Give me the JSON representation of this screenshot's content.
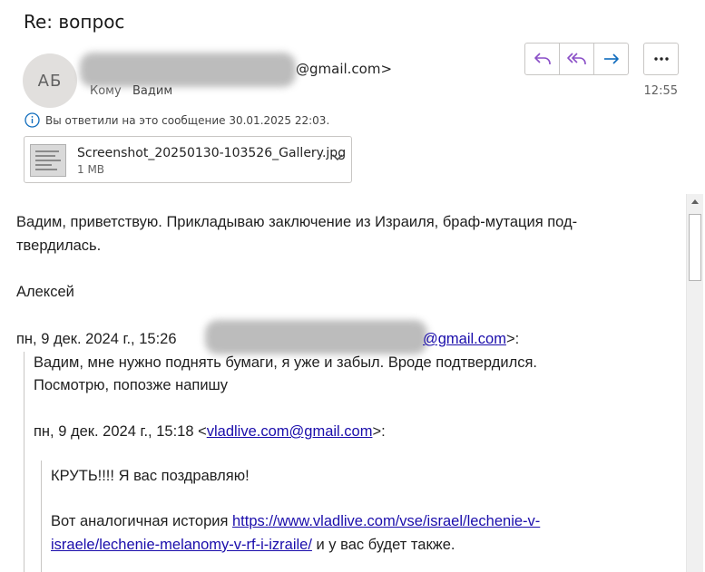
{
  "subject": "Re: вопрос",
  "sender": {
    "initials": "АБ",
    "email_domain": "@gmail.com>"
  },
  "recipient": {
    "label": "Кому",
    "name": "Вадим"
  },
  "time": "12:55",
  "info_text": "Вы ответили на это сообщение 30.01.2025 22:03.",
  "attachment": {
    "name": "Screenshot_20250130-103526_Gallery.jpg",
    "size": "1 МВ"
  },
  "actions": [
    "reply",
    "reply-all",
    "forward",
    "more"
  ],
  "message": {
    "greeting_line1": "Вадим, приветствую. Прикладываю заключение из Израиля, браф-мутация под-",
    "greeting_line2": "твердилась.",
    "signature": "Алексей",
    "quote1_header_prefix": "пн, 9 дек. 2024 г., 15:26 ",
    "quote1_header_email": "@gmail.com",
    "quote1_header_suffix": ">:",
    "quote1_line1": "Вадим, мне нужно поднять бумаги, я уже и забыл. Вроде подтвердился.",
    "quote1_line2": "Посмотрю, попозже напишу",
    "quote2_header_prefix": "пн, 9 дек. 2024 г., 15:18 <",
    "quote2_header_email": "vladlive.com@gmail.com",
    "quote2_header_suffix": ">:",
    "quote2_line1": "КРУТЬ!!!! Я вас поздравляю!",
    "quote2_line2_prefix": "Вот аналогичная история ",
    "quote2_link_part1": "https://www.vladlive.com/vse/israel/lechenie-v-",
    "quote2_link_part2": "israele/lechenie-melanomy-v-rf-i-izraile/",
    "quote2_line3_suffix": "  и у вас будет также."
  },
  "colors": {
    "accent": "#8a4fc7",
    "forward": "#0f6cbd",
    "link": "#1a0dab"
  }
}
